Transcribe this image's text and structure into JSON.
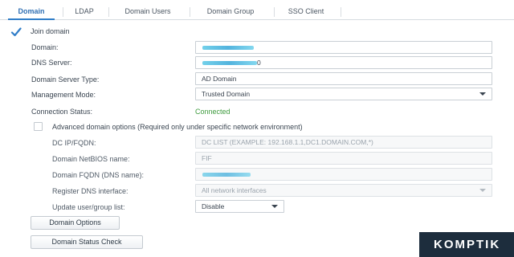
{
  "tabs": [
    {
      "label": "Domain",
      "active": true
    },
    {
      "label": "LDAP",
      "active": false
    },
    {
      "label": "Domain Users",
      "active": false
    },
    {
      "label": "Domain Group",
      "active": false
    },
    {
      "label": "SSO Client",
      "active": false
    }
  ],
  "join_domain": {
    "label": "Join domain",
    "checked": true
  },
  "form": {
    "domain": {
      "label": "Domain:",
      "value_redacted": true
    },
    "dns_server": {
      "label": "DNS Server:",
      "visible_tail": "0"
    },
    "domain_server_type": {
      "label": "Domain Server Type:",
      "value": "AD Domain"
    },
    "management_mode": {
      "label": "Management Mode:",
      "value": "Trusted Domain"
    },
    "connection_status": {
      "label": "Connection Status:",
      "value": "Connected"
    }
  },
  "advanced": {
    "label": "Advanced domain options (Required only under specific network environment)",
    "checked": false,
    "dc_ip": {
      "label": "DC IP/FQDN:",
      "placeholder": "DC LIST (EXAMPLE: 192.168.1.1,DC1.DOMAIN.COM,*)"
    },
    "netbios": {
      "label": "Domain NetBIOS name:",
      "value": "FIF"
    },
    "fqdn": {
      "label": "Domain FQDN (DNS name):",
      "value_redacted": true
    },
    "register_dns": {
      "label": "Register DNS interface:",
      "value": "All network interfaces"
    },
    "update_list": {
      "label": "Update user/group list:",
      "value": "Disable"
    }
  },
  "buttons": {
    "domain_options": "Domain Options",
    "domain_status_check": "Domain Status Check"
  },
  "watermark": "KOMPTIK",
  "colors": {
    "accent": "#2f7dc8",
    "status_ok": "#3c9a3c",
    "redaction": "#34a6d8"
  }
}
